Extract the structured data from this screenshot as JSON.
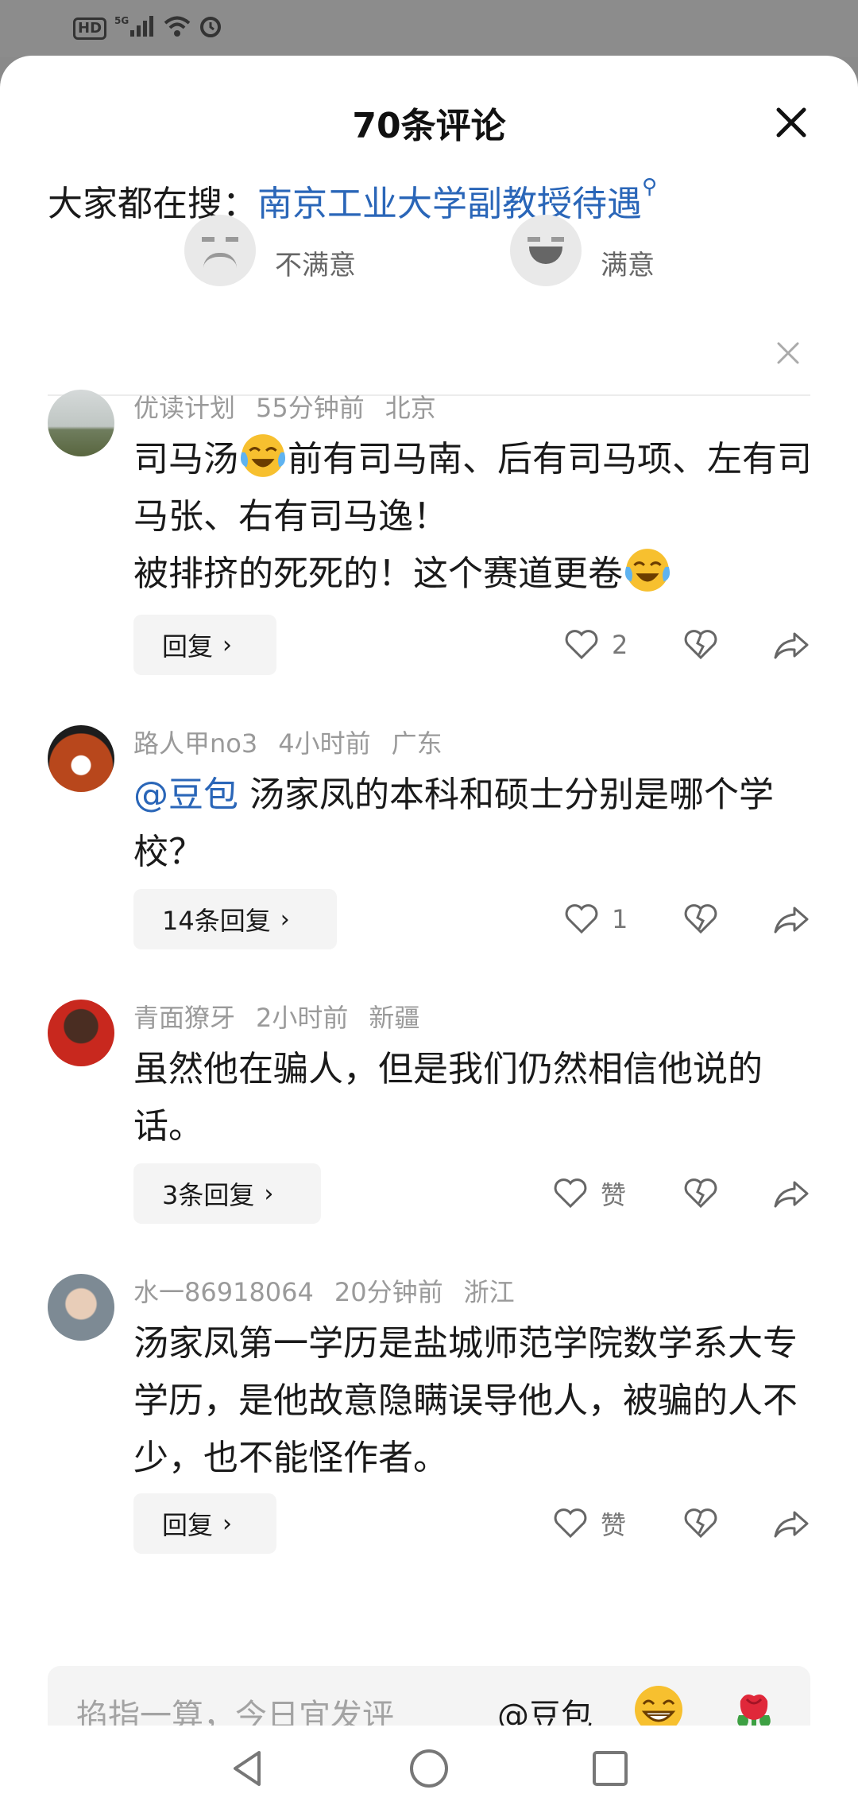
{
  "status_bar": {
    "hd": "HD",
    "signal": "5G"
  },
  "header": {
    "title": "70条评论"
  },
  "trending": {
    "prefix": "大家都在搜：",
    "query": "南京工业大学副教授待遇"
  },
  "satisfaction": {
    "unsatisfied": "不满意",
    "satisfied": "满意"
  },
  "comments": [
    {
      "user": "优读计划",
      "time": "55分钟前",
      "location": "北京",
      "text_a": "司马汤",
      "text_b": "前有司马南、后有司马项、左有司马张、右有司马逸！",
      "text_c": "被排挤的死死的！这个赛道更卷",
      "reply_label": "回复",
      "like_count": "2"
    },
    {
      "user": "路人甲no3",
      "time": "4小时前",
      "location": "广东",
      "mention": "@豆包",
      "text": " 汤家凤的本科和硕士分别是哪个学校？",
      "reply_label": "14条回复",
      "like_count": "1"
    },
    {
      "user": "青面獠牙",
      "time": "2小时前",
      "location": "新疆",
      "text": "虽然他在骗人，但是我们仍然相信他说的话。",
      "reply_label": "3条回复",
      "like_count": "赞"
    },
    {
      "user": "水一86918064",
      "time": "20分钟前",
      "location": "浙江",
      "text": "汤家凤第一学历是盐城师范学院数学系大专学历，是他故意隐瞒误导他人，被骗的人不少，也不能怪作者。",
      "reply_label": "回复",
      "like_count": "赞"
    }
  ],
  "input_bar": {
    "placeholder": "掐指一算，今日宜发评",
    "mention": "@豆包"
  },
  "colors": {
    "link": "#2a66b8",
    "meta": "#9a9a9a",
    "background": "#ffffff"
  }
}
